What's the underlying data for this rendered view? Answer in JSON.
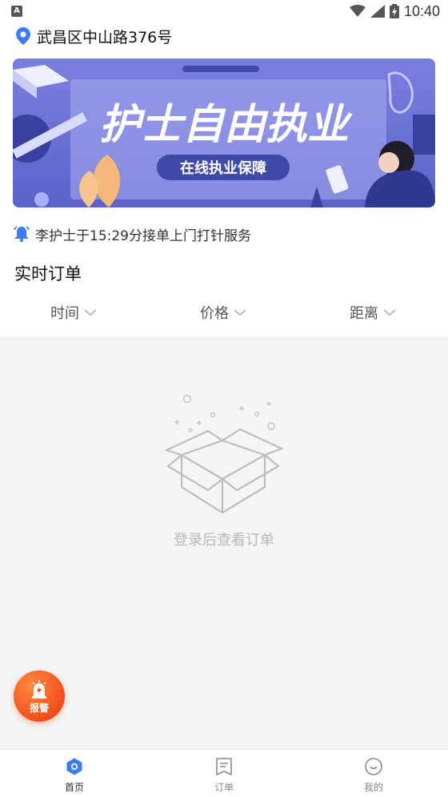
{
  "status_bar": {
    "left_badge": "A",
    "time": "10:40"
  },
  "location": {
    "address": "武昌区中山路376号"
  },
  "banner": {
    "headline": "护士自由执业",
    "subheadline": "在线执业保障",
    "colors": {
      "primary": "#6e73d8",
      "panel": "#8b90e6",
      "accent": "#2f3a8f"
    }
  },
  "notice": {
    "text": "李护士于15:29分接单上门打针服务"
  },
  "orders": {
    "title": "实时订单",
    "filters": [
      {
        "label": "时间"
      },
      {
        "label": "价格"
      },
      {
        "label": "距离"
      }
    ],
    "empty_text": "登录后查看订单"
  },
  "alarm": {
    "label": "报警",
    "color": "#f04a1b"
  },
  "tabs": [
    {
      "label": "首页",
      "icon": "home-icon",
      "active": true
    },
    {
      "label": "订单",
      "icon": "order-icon",
      "active": false
    },
    {
      "label": "我的",
      "icon": "profile-icon",
      "active": false
    }
  ],
  "colors": {
    "accent": "#3d7cf2",
    "background_gray": "#f5f5f5"
  }
}
